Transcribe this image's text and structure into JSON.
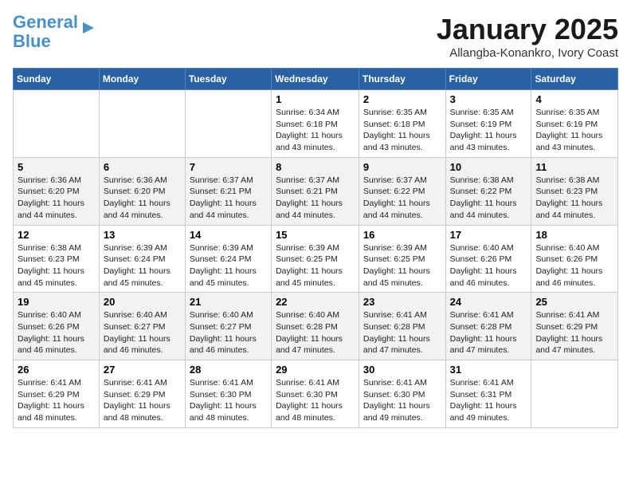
{
  "logo": {
    "line1": "General",
    "line2": "Blue"
  },
  "header": {
    "month": "January 2025",
    "location": "Allangba-Konankro, Ivory Coast"
  },
  "weekdays": [
    "Sunday",
    "Monday",
    "Tuesday",
    "Wednesday",
    "Thursday",
    "Friday",
    "Saturday"
  ],
  "weeks": [
    [
      {
        "day": "",
        "info": ""
      },
      {
        "day": "",
        "info": ""
      },
      {
        "day": "",
        "info": ""
      },
      {
        "day": "1",
        "info": "Sunrise: 6:34 AM\nSunset: 6:18 PM\nDaylight: 11 hours\nand 43 minutes."
      },
      {
        "day": "2",
        "info": "Sunrise: 6:35 AM\nSunset: 6:18 PM\nDaylight: 11 hours\nand 43 minutes."
      },
      {
        "day": "3",
        "info": "Sunrise: 6:35 AM\nSunset: 6:19 PM\nDaylight: 11 hours\nand 43 minutes."
      },
      {
        "day": "4",
        "info": "Sunrise: 6:35 AM\nSunset: 6:19 PM\nDaylight: 11 hours\nand 43 minutes."
      }
    ],
    [
      {
        "day": "5",
        "info": "Sunrise: 6:36 AM\nSunset: 6:20 PM\nDaylight: 11 hours\nand 44 minutes."
      },
      {
        "day": "6",
        "info": "Sunrise: 6:36 AM\nSunset: 6:20 PM\nDaylight: 11 hours\nand 44 minutes."
      },
      {
        "day": "7",
        "info": "Sunrise: 6:37 AM\nSunset: 6:21 PM\nDaylight: 11 hours\nand 44 minutes."
      },
      {
        "day": "8",
        "info": "Sunrise: 6:37 AM\nSunset: 6:21 PM\nDaylight: 11 hours\nand 44 minutes."
      },
      {
        "day": "9",
        "info": "Sunrise: 6:37 AM\nSunset: 6:22 PM\nDaylight: 11 hours\nand 44 minutes."
      },
      {
        "day": "10",
        "info": "Sunrise: 6:38 AM\nSunset: 6:22 PM\nDaylight: 11 hours\nand 44 minutes."
      },
      {
        "day": "11",
        "info": "Sunrise: 6:38 AM\nSunset: 6:23 PM\nDaylight: 11 hours\nand 44 minutes."
      }
    ],
    [
      {
        "day": "12",
        "info": "Sunrise: 6:38 AM\nSunset: 6:23 PM\nDaylight: 11 hours\nand 45 minutes."
      },
      {
        "day": "13",
        "info": "Sunrise: 6:39 AM\nSunset: 6:24 PM\nDaylight: 11 hours\nand 45 minutes."
      },
      {
        "day": "14",
        "info": "Sunrise: 6:39 AM\nSunset: 6:24 PM\nDaylight: 11 hours\nand 45 minutes."
      },
      {
        "day": "15",
        "info": "Sunrise: 6:39 AM\nSunset: 6:25 PM\nDaylight: 11 hours\nand 45 minutes."
      },
      {
        "day": "16",
        "info": "Sunrise: 6:39 AM\nSunset: 6:25 PM\nDaylight: 11 hours\nand 45 minutes."
      },
      {
        "day": "17",
        "info": "Sunrise: 6:40 AM\nSunset: 6:26 PM\nDaylight: 11 hours\nand 46 minutes."
      },
      {
        "day": "18",
        "info": "Sunrise: 6:40 AM\nSunset: 6:26 PM\nDaylight: 11 hours\nand 46 minutes."
      }
    ],
    [
      {
        "day": "19",
        "info": "Sunrise: 6:40 AM\nSunset: 6:26 PM\nDaylight: 11 hours\nand 46 minutes."
      },
      {
        "day": "20",
        "info": "Sunrise: 6:40 AM\nSunset: 6:27 PM\nDaylight: 11 hours\nand 46 minutes."
      },
      {
        "day": "21",
        "info": "Sunrise: 6:40 AM\nSunset: 6:27 PM\nDaylight: 11 hours\nand 46 minutes."
      },
      {
        "day": "22",
        "info": "Sunrise: 6:40 AM\nSunset: 6:28 PM\nDaylight: 11 hours\nand 47 minutes."
      },
      {
        "day": "23",
        "info": "Sunrise: 6:41 AM\nSunset: 6:28 PM\nDaylight: 11 hours\nand 47 minutes."
      },
      {
        "day": "24",
        "info": "Sunrise: 6:41 AM\nSunset: 6:28 PM\nDaylight: 11 hours\nand 47 minutes."
      },
      {
        "day": "25",
        "info": "Sunrise: 6:41 AM\nSunset: 6:29 PM\nDaylight: 11 hours\nand 47 minutes."
      }
    ],
    [
      {
        "day": "26",
        "info": "Sunrise: 6:41 AM\nSunset: 6:29 PM\nDaylight: 11 hours\nand 48 minutes."
      },
      {
        "day": "27",
        "info": "Sunrise: 6:41 AM\nSunset: 6:29 PM\nDaylight: 11 hours\nand 48 minutes."
      },
      {
        "day": "28",
        "info": "Sunrise: 6:41 AM\nSunset: 6:30 PM\nDaylight: 11 hours\nand 48 minutes."
      },
      {
        "day": "29",
        "info": "Sunrise: 6:41 AM\nSunset: 6:30 PM\nDaylight: 11 hours\nand 48 minutes."
      },
      {
        "day": "30",
        "info": "Sunrise: 6:41 AM\nSunset: 6:30 PM\nDaylight: 11 hours\nand 49 minutes."
      },
      {
        "day": "31",
        "info": "Sunrise: 6:41 AM\nSunset: 6:31 PM\nDaylight: 11 hours\nand 49 minutes."
      },
      {
        "day": "",
        "info": ""
      }
    ]
  ]
}
